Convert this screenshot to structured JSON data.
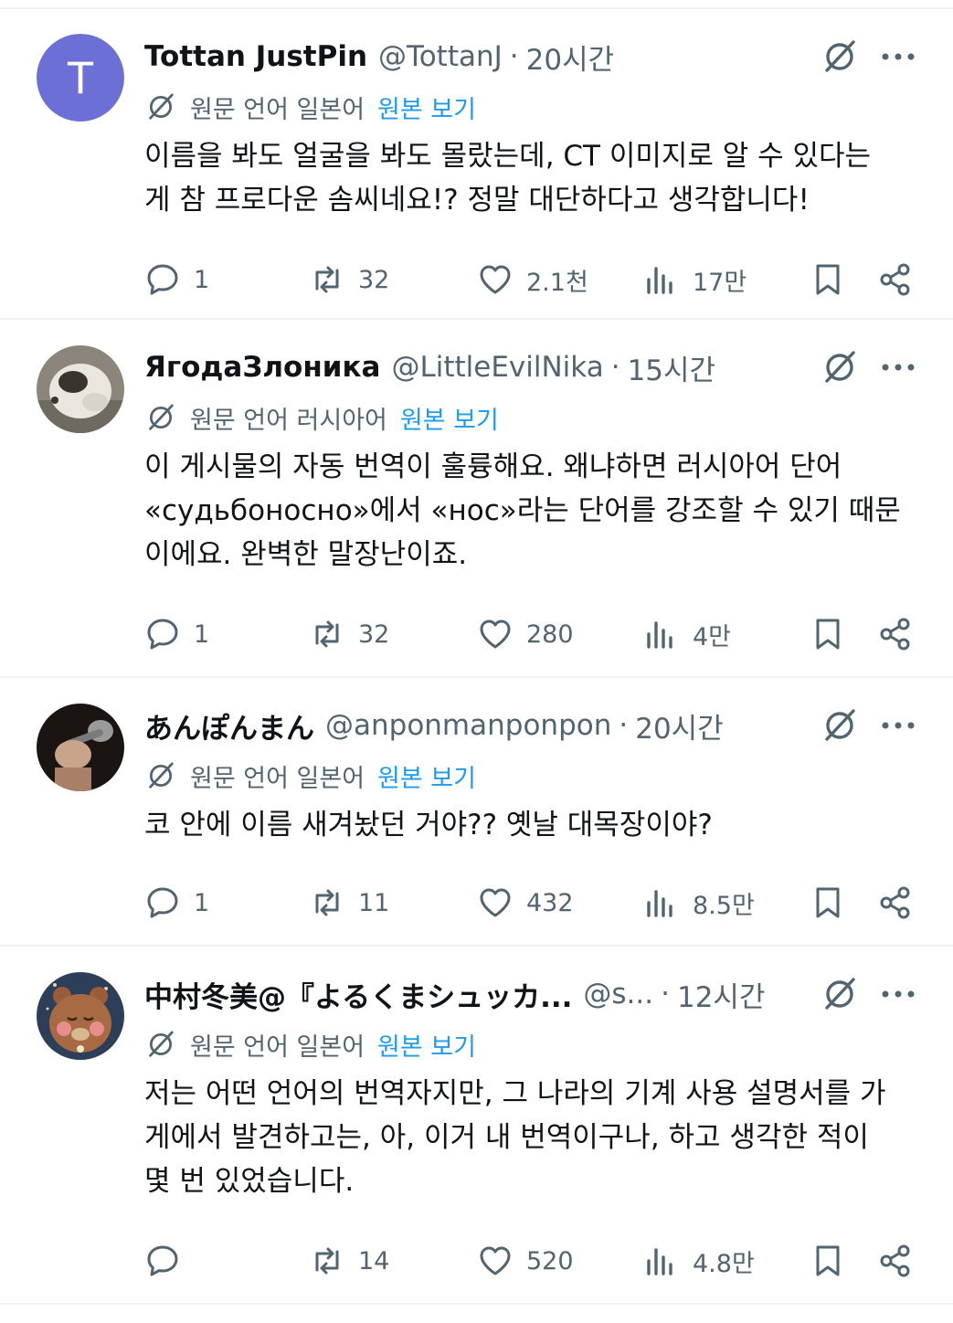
{
  "posts": [
    {
      "display_name": "Tottan JustPin",
      "handle": "@TottanJ",
      "dot": "·",
      "time": "20시간",
      "avatar_letter": "T",
      "avatar_color": "#6b6fd6",
      "translation": {
        "label": "원문 언어 일본어",
        "link": "원본 보기"
      },
      "text": "이름을 봐도 얼굴을 봐도 몰랐는데, CT 이미지로 알 수 있다는\n게 참 프로다운 솜씨네요!? 정말 대단하다고 생각합니다!",
      "replies": "1",
      "reposts": "32",
      "likes": "2.1천",
      "views": "17만"
    },
    {
      "display_name": "ЯгодаЗлоника",
      "handle": "@LittleEvilNika",
      "dot": "·",
      "time": "15시간",
      "avatar_letter": "",
      "translation": {
        "label": "원문 언어 러시아어",
        "link": "원본 보기"
      },
      "text": "이 게시물의 자동 번역이 훌륭해요. 왜냐하면 러시아어 단어\n«судьбоносно»에서 «нос»라는 단어를 강조할 수 있기 때문\n이에요. 완벽한 말장난이죠.",
      "replies": "1",
      "reposts": "32",
      "likes": "280",
      "views": "4만"
    },
    {
      "display_name": "あんぽんまん",
      "handle": "@anponmanponpon",
      "dot": "·",
      "time": "20시간",
      "avatar_letter": "",
      "translation": {
        "label": "원문 언어 일본어",
        "link": "원본 보기"
      },
      "text": "코 안에 이름 새겨놨던 거야?? 옛날 대목장이야?",
      "replies": "1",
      "reposts": "11",
      "likes": "432",
      "views": "8.5만"
    },
    {
      "display_name": "中村冬美@『よるくまシュッカ...",
      "handle": "@s...",
      "dot": "·",
      "time": "12시간",
      "avatar_letter": "",
      "translation": {
        "label": "원문 언어 일본어",
        "link": "원본 보기"
      },
      "text": "저는 어떤 언어의 번역자지만, 그 나라의 기계 사용 설명서를 가\n게에서 발견하고는, 아, 이거 내 번역이구나, 하고 생각한 적이\n몇 번 있었습니다.",
      "replies": "",
      "reposts": "14",
      "likes": "520",
      "views": "4.8만"
    }
  ],
  "icons": {
    "grok": "grok-icon",
    "more": "more-icon",
    "translate": "translate-icon",
    "reply": "reply-icon",
    "repost": "repost-icon",
    "like": "heart-icon",
    "views": "views-icon",
    "bookmark": "bookmark-icon",
    "share": "share-icon"
  },
  "colors": {
    "link": "#1d9bf0",
    "muted": "#536471",
    "text": "#0f1419"
  }
}
